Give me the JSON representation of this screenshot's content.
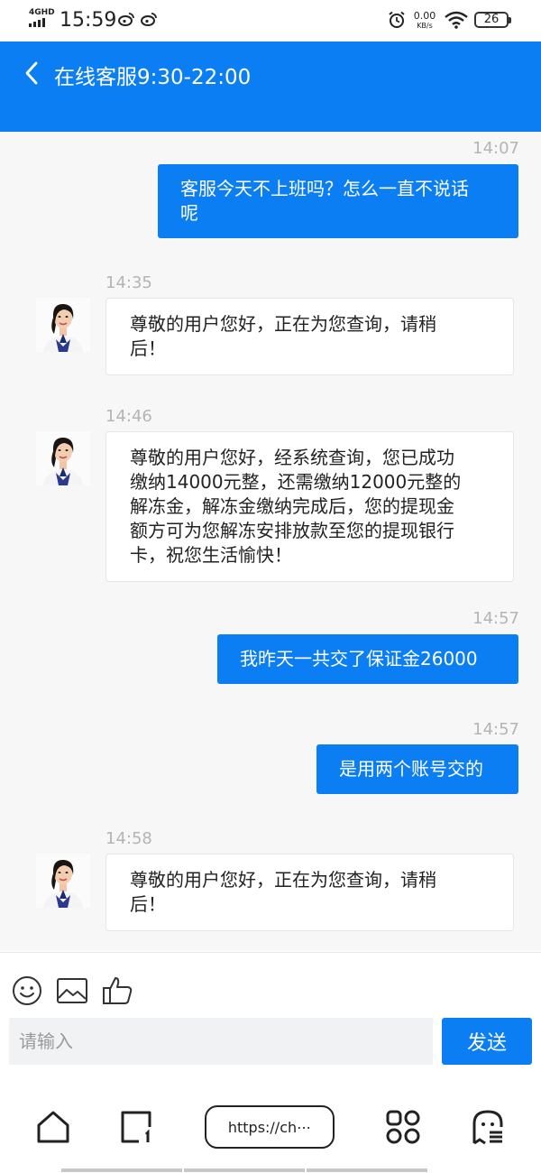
{
  "status_bar": {
    "network": "4GHD",
    "time": "15:59",
    "speed_value": "0.00",
    "speed_unit": "KB/s",
    "battery": "26"
  },
  "header": {
    "title": "在线客服9:30-22:00"
  },
  "messages": [
    {
      "side": "out",
      "time": "14:07",
      "lines": [
        "客服今天不上班吗？怎么一直不说话",
        "呢"
      ]
    },
    {
      "side": "in",
      "time": "14:35",
      "lines": [
        "尊敬的用户您好，正在为您查询，请稍",
        "后！"
      ]
    },
    {
      "side": "in",
      "time": "14:46",
      "lines": [
        "尊敬的用户您好，经系统查询，您已成功",
        "缴纳14000元整，还需缴纳12000元整的",
        "解冻金，解冻金缴纳完成后，您的提现金",
        "额方可为您解冻安排放款至您的提现银行",
        "卡，祝您生活愉快！"
      ]
    },
    {
      "side": "out",
      "time": "14:57",
      "lines": [
        "我昨天一共交了保证金26000"
      ]
    },
    {
      "side": "out",
      "time": "14:57",
      "lines": [
        "是用两个账号交的"
      ]
    },
    {
      "side": "in",
      "time": "14:58",
      "lines": [
        "尊敬的用户您好，正在为您查询，请稍",
        "后！"
      ]
    }
  ],
  "input": {
    "placeholder": "请输入",
    "send_label": "发送"
  },
  "browser": {
    "url": "https://ch⋯"
  },
  "colors": {
    "accent": "#0b7ef4",
    "chat_bg": "#f7f7f7"
  }
}
